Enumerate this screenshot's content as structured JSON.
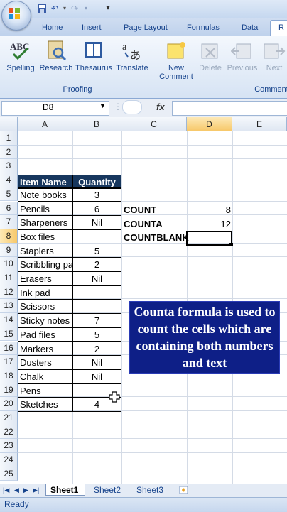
{
  "quick_access": {
    "undo": "↶",
    "redo": "↷",
    "customize": "▾"
  },
  "tabs": [
    "Home",
    "Insert",
    "Page Layout",
    "Formulas",
    "Data",
    "R"
  ],
  "ribbon": {
    "proofing": {
      "label": "Proofing",
      "buttons": [
        "Spelling",
        "Research",
        "Thesaurus",
        "Translate"
      ]
    },
    "comments": {
      "label": "Comment",
      "buttons": [
        "New\nComment",
        "Delete",
        "Previous",
        "Next"
      ]
    }
  },
  "namebox": "D8",
  "fx_symbol": "fx",
  "columns": [
    "A",
    "B",
    "C",
    "D",
    "E"
  ],
  "selected_column": "D",
  "selected_row": 8,
  "rows": [
    "1",
    "2",
    "3",
    "4",
    "5",
    "6",
    "7",
    "8",
    "9",
    "10",
    "11",
    "12",
    "13",
    "14",
    "15",
    "16",
    "17",
    "18",
    "19",
    "20",
    "21",
    "22",
    "23",
    "24",
    "25"
  ],
  "table": {
    "headers": [
      "Item Name",
      "Quantity"
    ],
    "items": [
      {
        "name": "Note books",
        "qty": "3"
      },
      {
        "name": "Pencils",
        "qty": "6"
      },
      {
        "name": "Sharpeners",
        "qty": "Nil"
      },
      {
        "name": "Box files",
        "qty": ""
      },
      {
        "name": "Staplers",
        "qty": "5"
      },
      {
        "name": "Scribbling pa",
        "qty": "2"
      },
      {
        "name": "Erasers",
        "qty": "Nil"
      },
      {
        "name": "Ink pad",
        "qty": ""
      },
      {
        "name": "Scissors",
        "qty": ""
      },
      {
        "name": "Sticky notes",
        "qty": "7"
      },
      {
        "name": "Pad files",
        "qty": "5"
      },
      {
        "name": "Markers",
        "qty": "2"
      },
      {
        "name": "Dusters",
        "qty": "Nil"
      },
      {
        "name": "Chalk",
        "qty": "Nil"
      },
      {
        "name": "Pens",
        "qty": ""
      },
      {
        "name": "Sketches",
        "qty": "4"
      }
    ],
    "header_color": "#17375e"
  },
  "functions": [
    {
      "label": "COUNT",
      "value": "8"
    },
    {
      "label": "COUNTA",
      "value": "12"
    },
    {
      "label": "COUNTBLANK",
      "value": ""
    }
  ],
  "callout": {
    "text": "Counta formula is used to count the cells which are containing both numbers and text",
    "bg": "#0e1f87"
  },
  "sheets": [
    "Sheet1",
    "Sheet2",
    "Sheet3"
  ],
  "active_sheet": "Sheet1",
  "status": "Ready"
}
